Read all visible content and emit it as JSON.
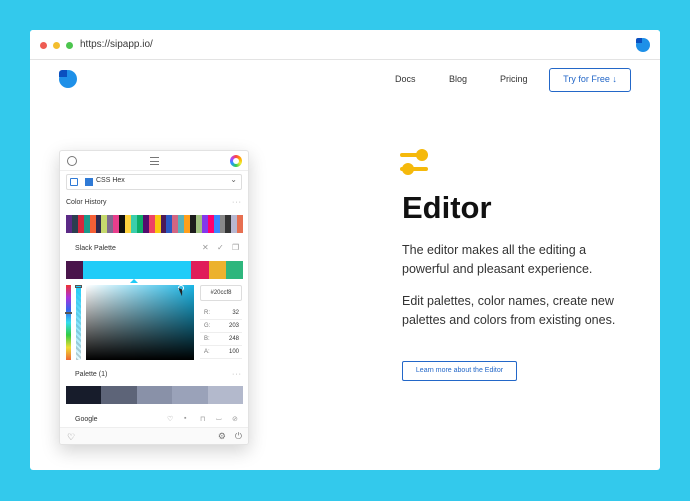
{
  "browser": {
    "url": "https://sipapp.io/"
  },
  "nav": {
    "links": [
      "Docs",
      "Blog",
      "Pricing"
    ],
    "cta": "Try for Free ↓"
  },
  "panel": {
    "format_select": "CSS Hex",
    "color_history_title": "Color History",
    "color_history": [
      "#5b2a86",
      "#2c3e50",
      "#d7263d",
      "#1b998b",
      "#f46036",
      "#2e294e",
      "#c5d86d",
      "#7e6b8f",
      "#e83e8c",
      "#111111",
      "#ffd23f",
      "#3bceac",
      "#0ead69",
      "#540d6e",
      "#ee4266",
      "#f9c80e",
      "#4c1a57",
      "#2b59c3",
      "#d36582",
      "#5ab1bb",
      "#ff9f1c",
      "#1c1c1c",
      "#a1c181",
      "#8338ec",
      "#ff006e",
      "#3a86ff",
      "#888888",
      "#333333",
      "#b8b8d1",
      "#e76f51"
    ],
    "slack_palette_title": "Slack Palette",
    "slack_palette": [
      "#4a154b",
      "#20ccf8",
      "#20ccf8",
      "#e01e5a",
      "#ecb22e",
      "#2eb67d"
    ],
    "hex_value": "#20ccf8",
    "rgba": [
      {
        "label": "R:",
        "value": "32"
      },
      {
        "label": "G:",
        "value": "203"
      },
      {
        "label": "B:",
        "value": "248"
      },
      {
        "label": "A:",
        "value": "100"
      }
    ],
    "palette1_title": "Palette (1)",
    "palette1": [
      "#171c2b",
      "#5d6478",
      "#8991a8",
      "#9aa2b9",
      "#b3b9cc"
    ],
    "google_title": "Google",
    "more": "···"
  },
  "feature": {
    "title": "Editor",
    "para1": "The editor makes all the editing a powerful and pleasant experience.",
    "para2": "Edit palettes, color names, create new palettes and colors from existing ones.",
    "learn_more": "Learn more about the Editor"
  },
  "colors": {
    "accent": "#2367c8",
    "background": "#33c9ec",
    "feature_icon": "#f5b90b"
  }
}
